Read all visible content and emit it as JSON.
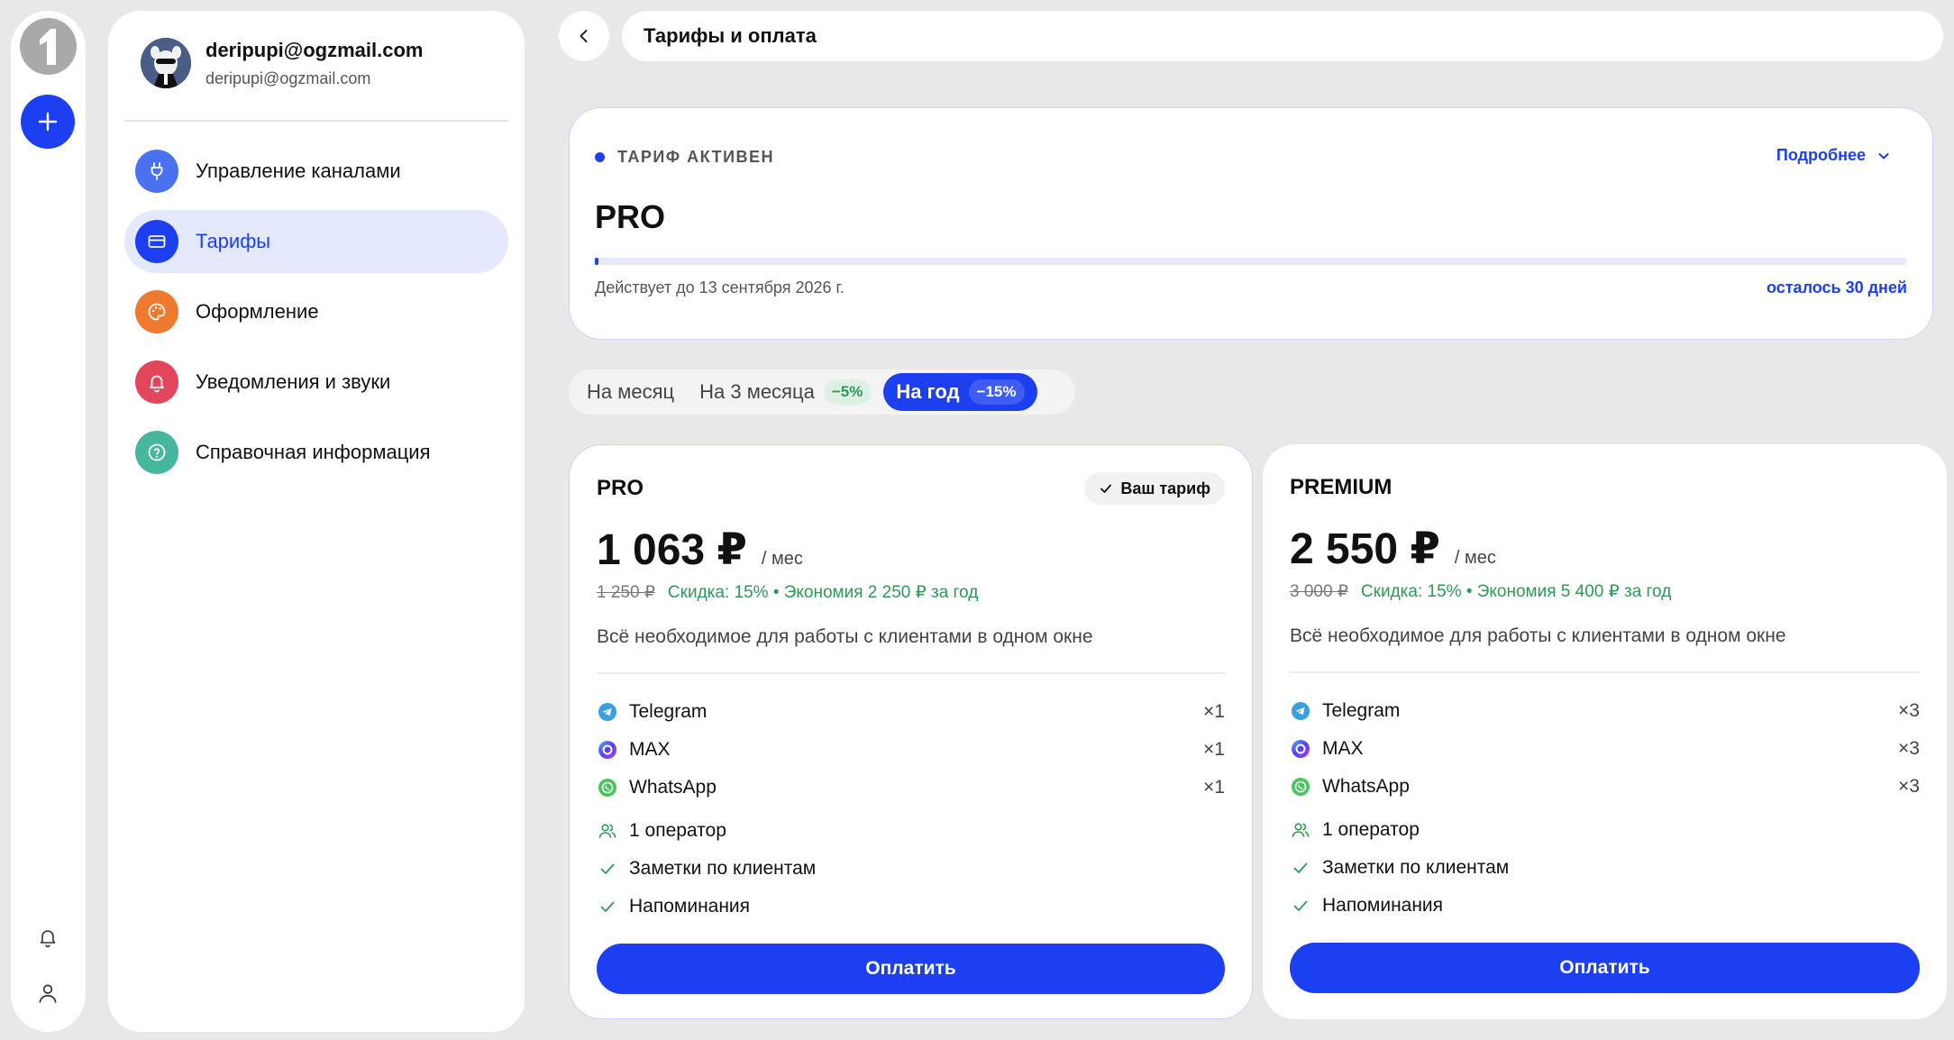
{
  "rail": {
    "logo_text": "1"
  },
  "profile": {
    "name": "deripupi@ogzmail.com",
    "email": "deripupi@ogzmail.com"
  },
  "menu": [
    {
      "label": "Управление каналами",
      "icon": "plug-icon",
      "color": "#4a72f0"
    },
    {
      "label": "Тарифы",
      "icon": "card-icon",
      "color": "#1d3ff2",
      "active": true
    },
    {
      "label": "Оформление",
      "icon": "palette-icon",
      "color": "#ef7a2f"
    },
    {
      "label": "Уведомления и звуки",
      "icon": "bell-icon",
      "color": "#e3455b"
    },
    {
      "label": "Справочная информация",
      "icon": "help-icon",
      "color": "#45b79c"
    }
  ],
  "header": {
    "title": "Тарифы и оплата"
  },
  "active_plan": {
    "status": "ТАРИФ АКТИВЕН",
    "more_label": "Подробнее",
    "plan_name": "PRO",
    "progress": 0.002,
    "valid_until": "Действует до 13 сентября 2026 г.",
    "days_left": "осталось 30 дней"
  },
  "period": {
    "options": [
      {
        "label": "На месяц",
        "badge": ""
      },
      {
        "label": "На 3 месяца",
        "badge": "−5%"
      },
      {
        "label": "На год",
        "badge": "−15%",
        "active": true
      }
    ]
  },
  "plans": [
    {
      "title": "PRO",
      "current_badge": "Ваш тариф",
      "price": "1 063 ₽",
      "per": "/ мес",
      "old_price": "1 250 ₽",
      "discount": "Скидка: 15% • Экономия 2 250 ₽ за год",
      "description": "Всё необходимое для работы с клиентами в одном окне",
      "channels": [
        {
          "name": "Telegram",
          "count": "×1"
        },
        {
          "name": "MAX",
          "count": "×1"
        },
        {
          "name": "WhatsApp",
          "count": "×1"
        }
      ],
      "operators": "1 оператор",
      "notes": "Заметки по клиентам",
      "reminders": "Напоминания",
      "pay_label": "Оплатить"
    },
    {
      "title": "PREMIUM",
      "price": "2 550 ₽",
      "per": "/ мес",
      "old_price": "3 000 ₽",
      "discount": "Скидка: 15% • Экономия 5 400 ₽ за год",
      "description": "Всё необходимое для работы с клиентами в одном окне",
      "channels": [
        {
          "name": "Telegram",
          "count": "×3"
        },
        {
          "name": "MAX",
          "count": "×3"
        },
        {
          "name": "WhatsApp",
          "count": "×3"
        }
      ],
      "operators": "1 оператор",
      "notes": "Заметки по клиентам",
      "reminders": "Напоминания",
      "pay_label": "Оплатить"
    }
  ],
  "colors": {
    "accent": "#1d3ff2",
    "success": "#2c9a55",
    "background": "#e8e8e8"
  }
}
